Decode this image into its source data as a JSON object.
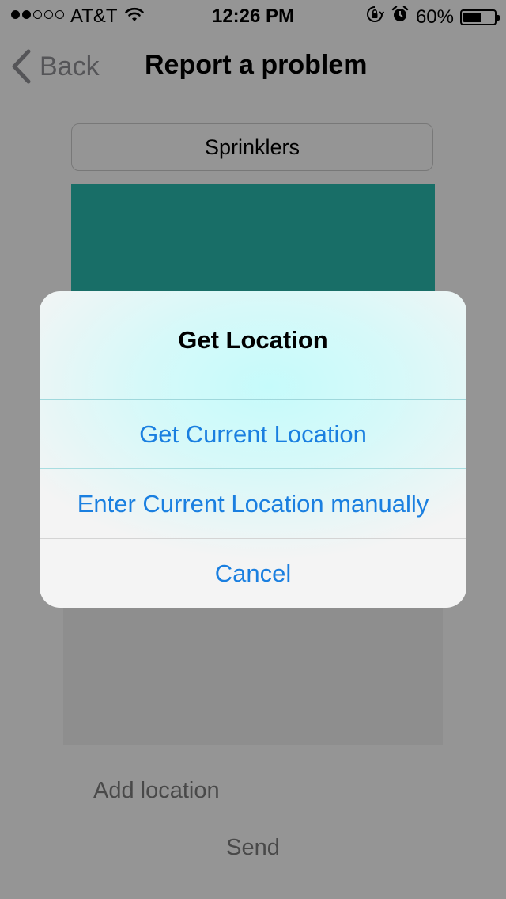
{
  "status_bar": {
    "carrier": "AT&T",
    "time": "12:26 PM",
    "battery": "60%",
    "battery_level": 0.6,
    "signal_bars_filled": 2,
    "signal_bars_total": 5,
    "icons": [
      "wifi-icon",
      "orientation-lock-icon",
      "alarm-icon",
      "battery-icon"
    ]
  },
  "nav": {
    "back_label": "Back",
    "title": "Report a problem"
  },
  "form": {
    "category": "Sprinklers",
    "add_location_label": "Add location",
    "send_label": "Send",
    "photo_color": "#28b8ac"
  },
  "alert": {
    "title": "Get Location",
    "actions": [
      "Get Current Location",
      "Enter Current Location manually",
      "Cancel"
    ],
    "action_color": "#1a7fe0"
  }
}
